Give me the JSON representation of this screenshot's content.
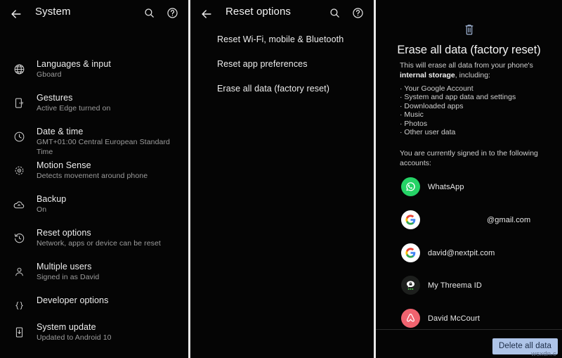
{
  "colors": {
    "background": "#050505",
    "divider": "#e8e8e8",
    "primary_text": "#eeeeee",
    "secondary_text": "#9d9d9d",
    "accent_trash": "#aec4e8",
    "button_bg": "#aec4e8",
    "button_text": "#1c2c46",
    "whatsapp_green": "#25d366",
    "airbnb_pink": "#f0636f",
    "threema_dark": "#1d1f1d"
  },
  "panel_system": {
    "appbar": {
      "back_icon": "arrow-back-icon",
      "title": "System",
      "search_icon": "search-icon",
      "help_icon": "help-circle-icon"
    },
    "items": [
      {
        "icon": "globe-icon",
        "title": "Languages & input",
        "subtitle": "Gboard"
      },
      {
        "icon": "gesture-phone-icon",
        "title": "Gestures",
        "subtitle": "Active Edge turned on"
      },
      {
        "icon": "clock-icon",
        "title": "Date & time",
        "subtitle": "GMT+01:00 Central European Standard Time"
      },
      {
        "icon": "motion-sense-icon",
        "title": "Motion Sense",
        "subtitle": "Detects movement around phone"
      },
      {
        "icon": "cloud-upload-icon",
        "title": "Backup",
        "subtitle": "On"
      },
      {
        "icon": "history-restore-icon",
        "title": "Reset options",
        "subtitle": "Network, apps or device can be reset"
      },
      {
        "icon": "person-icon",
        "title": "Multiple users",
        "subtitle": "Signed in as David"
      },
      {
        "icon": "braces-icon",
        "title": "Developer options",
        "subtitle": ""
      },
      {
        "icon": "phone-download-icon",
        "title": "System update",
        "subtitle": "Updated to Android 10"
      }
    ]
  },
  "panel_reset": {
    "appbar": {
      "back_icon": "arrow-back-icon",
      "title": "Reset options",
      "search_icon": "search-icon",
      "help_icon": "help-circle-icon"
    },
    "options": [
      "Reset Wi-Fi, mobile & Bluetooth",
      "Reset app preferences",
      "Erase all data (factory reset)"
    ]
  },
  "panel_erase": {
    "trash_icon": "trash-can-icon",
    "title": "Erase all data (factory reset)",
    "description_prefix": "This will erase all data from your phone's ",
    "description_bold": "internal storage",
    "description_suffix": ", including:",
    "bullets": [
      "Your Google Account",
      "System and app data and settings",
      "Downloaded apps",
      "Music",
      "Photos",
      "Other user data"
    ],
    "accounts_note": "You are currently signed in to the following accounts:",
    "accounts": [
      {
        "avatar": "whatsapp-icon",
        "name": "WhatsApp",
        "indented": false
      },
      {
        "avatar": "google-icon",
        "name": "@gmail.com",
        "indented": true
      },
      {
        "avatar": "google-icon",
        "name": "david@nextpit.com",
        "indented": false
      },
      {
        "avatar": "threema-icon",
        "name": "My Threema ID",
        "indented": false
      },
      {
        "avatar": "airbnb-icon",
        "name": "David McCourt",
        "indented": false
      }
    ],
    "delete_button_label": "Delete all data",
    "watermark": "wsxdn.c"
  }
}
